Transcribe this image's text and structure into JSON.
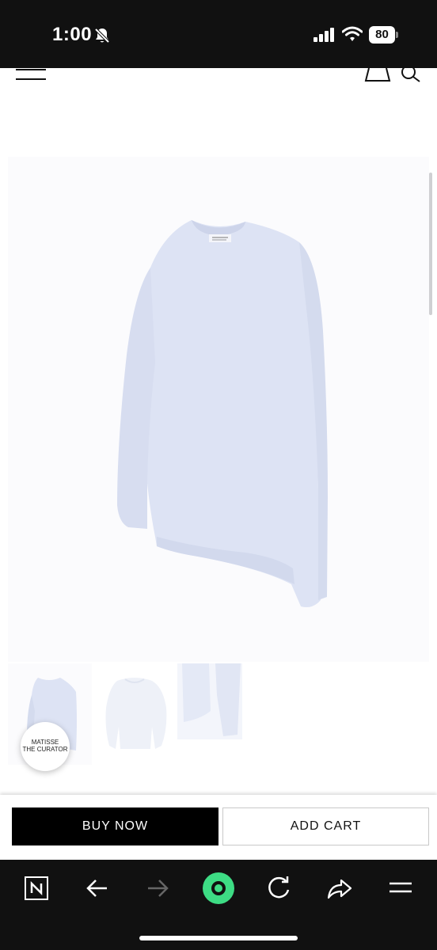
{
  "status_bar": {
    "time": "1:00",
    "battery_level": "80",
    "icons": [
      "bell-slash-icon",
      "signal-icon",
      "wifi-icon",
      "battery-icon"
    ]
  },
  "header": {
    "icons": [
      "menu-icon",
      "shopping-bag-icon",
      "search-icon"
    ]
  },
  "product": {
    "image_alt_icon": "sweater-photo",
    "thumbnail_count": 3
  },
  "brand_badge": {
    "line1": "MATISSE",
    "line2": "THE CURATOR"
  },
  "actions": {
    "buy_now": "BUY NOW",
    "add_cart": "ADD CART"
  },
  "browser_toolbar": {
    "icons": [
      "naver-n-icon",
      "back-arrow-icon",
      "forward-arrow-icon",
      "green-dot-icon",
      "reload-icon",
      "share-icon",
      "menu-lines-icon"
    ]
  },
  "colors": {
    "status_bar_bg": "#111111",
    "sweater": "#dde3f4",
    "buy_button_bg": "#000000",
    "green_accent": "#3ddc84"
  }
}
